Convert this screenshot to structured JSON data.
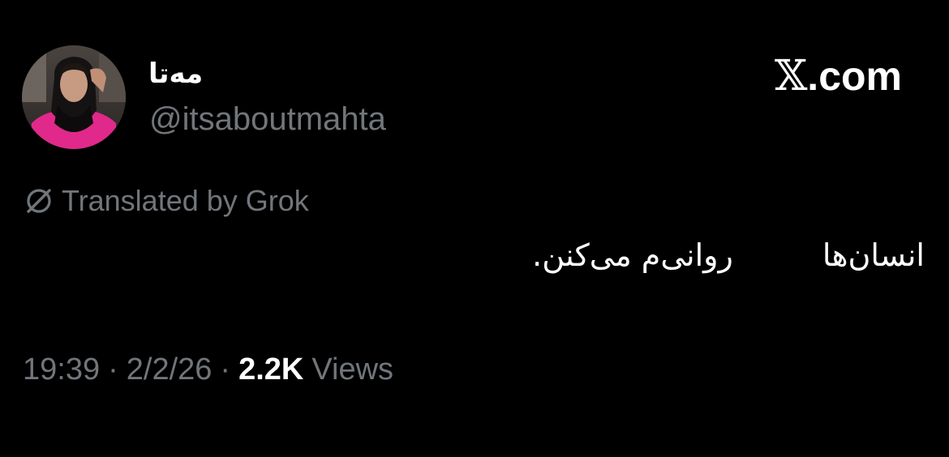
{
  "brand": {
    "x_glyph": "𝕏",
    "domain": ".com",
    "icon": "x-logo-icon"
  },
  "author": {
    "display_name": "مەتا",
    "handle": "@itsaboutmahta",
    "avatar_icon": "profile-photo-avatar"
  },
  "translation": {
    "label": "Translated by Grok",
    "icon": "grok-translate-icon"
  },
  "tweet": {
    "line1_part1": "انسان‌ها",
    "line1_part2": "روانی‌م می‌کنن."
  },
  "meta": {
    "time": "19:39",
    "separator": "·",
    "date": "2/2/26",
    "views_count": "2.2K",
    "views_label": "Views"
  },
  "colors": {
    "background": "#000000",
    "primary_text": "#ffffff",
    "secondary_text": "#71767b",
    "avatar_shirt": "#e0298a"
  }
}
